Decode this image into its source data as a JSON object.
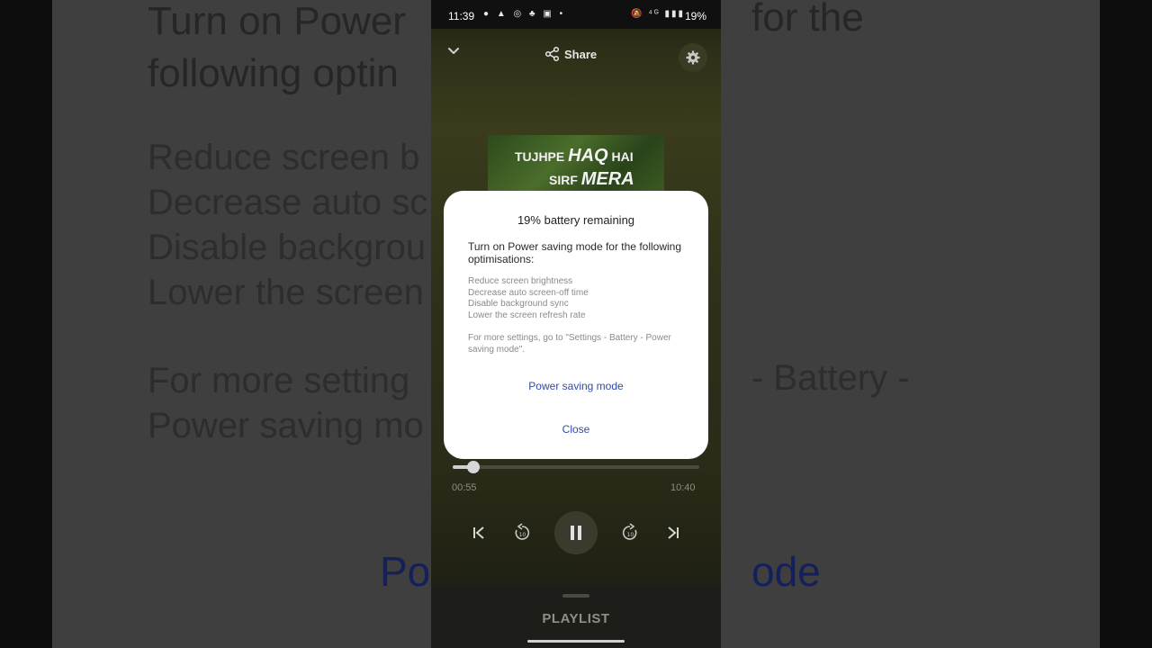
{
  "background": {
    "title": "Turn on Power saving mode for the\nfollowing optimisations:",
    "title_left": "Turn on Power\nfollowing optin",
    "title_right": "for the",
    "list": "Reduce screen b\nDecrease auto sc\nDisable backgrou\nLower the screen",
    "more_left": "For more setting\nPower saving mo",
    "more_right": "- Battery -",
    "link_left": "Po",
    "link_right": "ode"
  },
  "status_bar": {
    "time": "11:39",
    "left_icons": "● ▲ ◎ ♣ ▣ •",
    "right_icons": "🔕 ⁴ᴳ ▮▮▮",
    "battery": "19%"
  },
  "player": {
    "share_label": "Share",
    "cover": {
      "line1_a": "TUJHPE ",
      "line1_b": "HAQ",
      "line1_c": " HAI",
      "line2_a": "SIRF ",
      "line2_b": "MERA"
    },
    "elapsed": "00:55",
    "total": "10:40",
    "progress_fraction": 0.085,
    "playlist_label": "PLAYLIST"
  },
  "dialog": {
    "title": "19% battery remaining",
    "intro": "Turn on Power saving mode for the following optimisations:",
    "items": [
      "Reduce screen brightness",
      "Decrease auto screen-off time",
      "Disable background sync",
      "Lower the screen refresh rate"
    ],
    "more": "For more settings, go to \"Settings - Battery - Power saving mode\".",
    "primary_button": "Power saving mode",
    "close_button": "Close"
  }
}
